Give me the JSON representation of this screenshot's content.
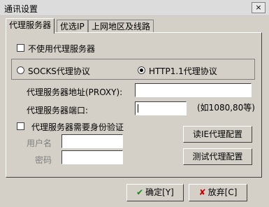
{
  "window": {
    "title": "通讯设置",
    "close_label": "×"
  },
  "tabs": [
    {
      "label": "代理服务器",
      "active": true
    },
    {
      "label": "优选IP",
      "active": false
    },
    {
      "label": "上网地区及线路",
      "active": false
    }
  ],
  "proxy": {
    "no_proxy_label": "不使用代理服务器",
    "no_proxy_checked": false,
    "socks_label": "SOCKS代理协议",
    "http_label": "HTTP1.1代理协议",
    "selected_protocol": "HTTP1.1代理协议",
    "address_label": "代理服务器地址(PROXY):",
    "address_value": "",
    "port_label": "代理服务器端口:",
    "port_value": "",
    "port_hint": "(如1080,80等)",
    "auth_label": "代理服务器需要身份验证",
    "auth_checked": false,
    "username_label": "用户名",
    "username_value": "",
    "password_label": "密码",
    "password_value": "",
    "read_ie_button": "读IE代理配置",
    "test_button": "测试代理配置"
  },
  "footer": {
    "ok_label": "确定[Y]",
    "cancel_label": "放弃[C]"
  },
  "colors": {
    "ok": "#1a8a1a",
    "cancel": "#cc0000"
  }
}
